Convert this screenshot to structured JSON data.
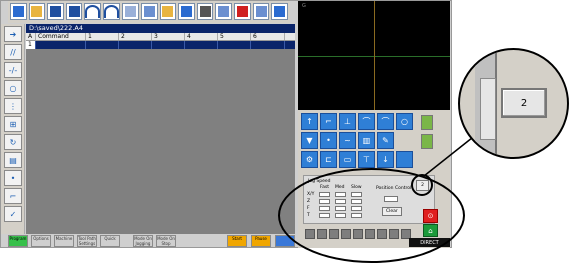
{
  "file_path": "D:\\saved\\222.A4",
  "table": {
    "columns": [
      "A",
      "Command",
      "1",
      "2",
      "3",
      "4",
      "5",
      "6"
    ],
    "selected_row": [
      "1",
      "",
      "",
      "",
      "",
      "",
      "",
      ""
    ]
  },
  "graphic_label": "G",
  "jog": {
    "title": "Jog Speed",
    "fast": "Fast",
    "med": "Med",
    "slow": "Slow",
    "row_labels": [
      "X/Y",
      "Z",
      "F",
      "T"
    ],
    "position_title": "Position Control",
    "clear": "Clear"
  },
  "bottom_buttons": [
    "Program",
    "Options",
    "Machine",
    "Tool Path Settings",
    "Quick",
    "Mode On Jogging",
    "Mode On Stop",
    "",
    "Start",
    "Pause",
    ""
  ],
  "callout_value": "2",
  "small_button_value": "2",
  "status_text": "DIRECT",
  "colors": {
    "selection_blue": "#0a246a",
    "button_blue": "#2f7fd6",
    "stop_red": "#e02020",
    "go_green": "#1b9a3a"
  }
}
